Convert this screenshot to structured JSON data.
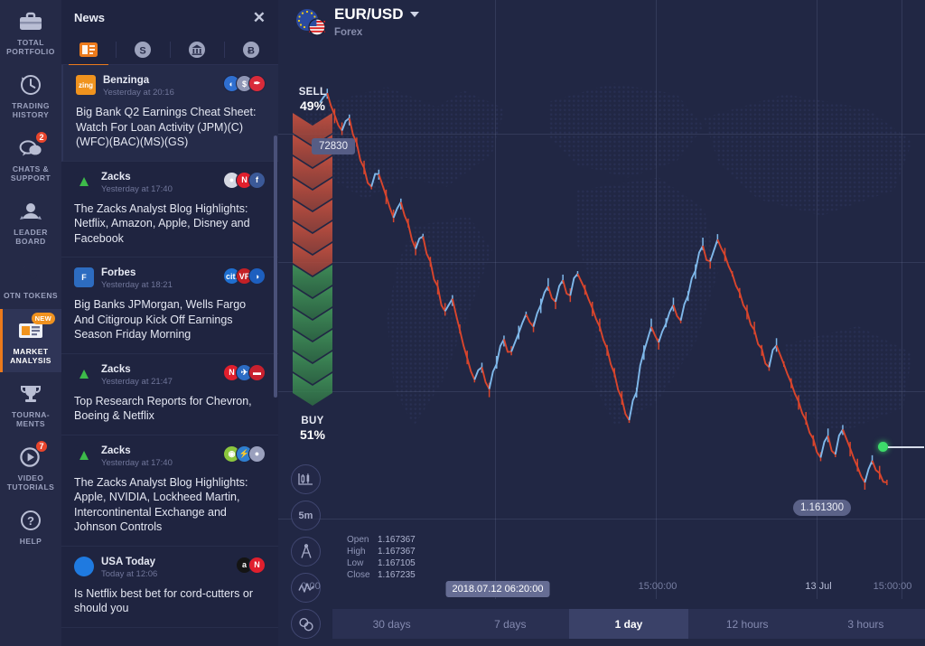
{
  "nav": {
    "items": [
      {
        "label": "TOTAL PORTFOLIO",
        "icon": "briefcase-icon",
        "badge": null,
        "active": false
      },
      {
        "label": "TRADING HISTORY",
        "icon": "clock-history-icon",
        "badge": null,
        "active": false
      },
      {
        "label": "CHATS & SUPPORT",
        "icon": "chat-bubbles-icon",
        "badge": "2",
        "active": false
      },
      {
        "label": "LEADER BOARD",
        "icon": "podium-icon",
        "badge": null,
        "active": false
      },
      {
        "label": "OTN TOKENS",
        "icon": "otn-token-icon",
        "badge": null,
        "active": false
      },
      {
        "label": "MARKET ANALYSIS",
        "icon": "news-card-icon",
        "badge": "NEW",
        "active": true
      },
      {
        "label": "TOURNA- MENTS",
        "icon": "trophy-icon",
        "badge": null,
        "active": false
      },
      {
        "label": "VIDEO TUTORIALS",
        "icon": "play-circle-icon",
        "badge": "7",
        "active": false
      },
      {
        "label": "HELP",
        "icon": "question-circle-icon",
        "badge": null,
        "active": false
      }
    ]
  },
  "news": {
    "title": "News",
    "close_label": "✕",
    "tabs": [
      {
        "name": "newspaper-icon",
        "glyph": "",
        "active": true
      },
      {
        "name": "dollar-icon",
        "glyph": "S",
        "active": false
      },
      {
        "name": "bank-icon",
        "glyph": "⌂",
        "active": false
      },
      {
        "name": "bitcoin-icon",
        "glyph": "Ƀ",
        "active": false
      }
    ],
    "items": [
      {
        "source": "Benzinga",
        "time": "Yesterday at 20:16",
        "avatar_text": "zing",
        "avatar_color": "#f0931e",
        "tags": [
          {
            "text": "◐",
            "color": "#2f6fd0"
          },
          {
            "text": "$",
            "color": "#8f96b5"
          },
          {
            "text": "✒",
            "color": "#d92b3a"
          }
        ],
        "headline": "Big Bank Q2 Earnings Cheat Sheet: Watch For Loan Activity (JPM)(C)(WFC)(BAC)(MS)(GS)"
      },
      {
        "source": "Zacks",
        "time": "Yesterday at 17:40",
        "avatar_text": "▲",
        "avatar_color": "#1f2440",
        "tags": [
          {
            "text": "●",
            "color": "#d5d8e2"
          },
          {
            "text": "N",
            "color": "#e01f2d"
          },
          {
            "text": "f",
            "color": "#3b5998"
          }
        ],
        "headline": "The Zacks Analyst Blog Highlights: Netflix, Amazon, Apple, Disney and Facebook"
      },
      {
        "source": "Forbes",
        "time": "Yesterday at 18:21",
        "avatar_text": "F",
        "avatar_color": "#2d6cc0",
        "tags": [
          {
            "text": "citi",
            "color": "#1f6fd0"
          },
          {
            "text": "VF",
            "color": "#c32026"
          },
          {
            "text": "◑",
            "color": "#1d5fbf"
          }
        ],
        "headline": "Big Banks JPMorgan, Wells Fargo And Citigroup Kick Off Earnings Season Friday Morning"
      },
      {
        "source": "Zacks",
        "time": "Yesterday at 21:47",
        "avatar_text": "▲",
        "avatar_color": "#1f2440",
        "tags": [
          {
            "text": "N",
            "color": "#e01f2d"
          },
          {
            "text": "✈",
            "color": "#2c6cc4"
          },
          {
            "text": "▬",
            "color": "#c8202e"
          }
        ],
        "headline": "Top Research Reports for Chevron, Boeing & Netflix"
      },
      {
        "source": "Zacks",
        "time": "Yesterday at 17:40",
        "avatar_text": "▲",
        "avatar_color": "#1f2440",
        "tags": [
          {
            "text": "◉",
            "color": "#8cc63e"
          },
          {
            "text": "⚡",
            "color": "#2f7fd0"
          },
          {
            "text": "●",
            "color": "#9aa0bd"
          }
        ],
        "headline": "The Zacks Analyst Blog Highlights: Apple, NVIDIA, Lockheed Martin, Intercontinental Exchange and Johnson Controls"
      },
      {
        "source": "USA Today",
        "time": "Today at 12:06",
        "avatar_text": "",
        "avatar_color": "#1f7ae0",
        "tags": [
          {
            "text": "a",
            "color": "#141414"
          },
          {
            "text": "N",
            "color": "#e01f2d"
          }
        ],
        "headline": "Is Netflix best bet for cord-cutters or should you"
      }
    ]
  },
  "chart": {
    "symbol": "EUR/USD",
    "market_type": "Forex",
    "sentiment": {
      "sell_label": "SELL",
      "sell_percent": "49%",
      "buy_label": "BUY",
      "buy_percent": "51%",
      "sell_color": "#c04a3c",
      "buy_color": "#3d8a4e"
    },
    "tools": [
      {
        "name": "chart-type-icon",
        "label": ""
      },
      {
        "name": "timeframe-icon",
        "label": "5m"
      },
      {
        "name": "drawing-tools-icon",
        "label": ""
      },
      {
        "name": "indicators-icon",
        "label": ""
      },
      {
        "name": "chart-settings-icon",
        "label": ""
      }
    ],
    "ohlc": {
      "open_label": "Open",
      "open_value": "1.167367",
      "high_label": "High",
      "high_value": "1.167367",
      "low_label": "Low",
      "low_value": "1.167105",
      "close_label": "Close",
      "close_value": "1.167235"
    },
    "price_labels": [
      {
        "name": "upper-price-label",
        "text": "72830"
      },
      {
        "name": "current-price-label",
        "text": "1.161300"
      }
    ],
    "time_ticks": [
      {
        "text": "0:00",
        "highlight": false,
        "bold": false
      },
      {
        "text": "2018.07.12 06:20:00",
        "highlight": true,
        "bold": false
      },
      {
        "text": "15:00:00",
        "highlight": false,
        "bold": false
      },
      {
        "text": "13 Jul",
        "highlight": false,
        "bold": true
      },
      {
        "text": "15:00:00",
        "highlight": false,
        "bold": false
      }
    ],
    "timeframes": [
      {
        "label": "30 days",
        "active": false
      },
      {
        "label": "7 days",
        "active": false
      },
      {
        "label": "1 day",
        "active": true
      },
      {
        "label": "12 hours",
        "active": false
      },
      {
        "label": "3 hours",
        "active": false
      }
    ]
  },
  "chart_data": {
    "type": "line",
    "title": "EUR/USD",
    "xlabel": "",
    "ylabel": "",
    "x": [
      "0:00",
      "2018.07.12 06:20:00",
      "15:00:00",
      "13 Jul",
      "15:00:00"
    ],
    "ylim": [
      1.1605,
      1.174
    ],
    "up_color": "#7fb8ea",
    "down_color": "#d9452c",
    "series": [
      {
        "name": "EUR/USD close",
        "values": [
          1.1735,
          1.1738,
          1.1731,
          1.1726,
          1.173,
          1.1722,
          1.1714,
          1.1708,
          1.1712,
          1.1705,
          1.1698,
          1.1703,
          1.1696,
          1.1688,
          1.1692,
          1.1684,
          1.1676,
          1.1668,
          1.1672,
          1.1662,
          1.1653,
          1.1646,
          1.165,
          1.1643,
          1.1651,
          1.1659,
          1.1655,
          1.1661,
          1.1667,
          1.1663,
          1.167,
          1.1676,
          1.1671,
          1.1678,
          1.1673,
          1.168,
          1.1675,
          1.1669,
          1.1663,
          1.1656,
          1.1648,
          1.164,
          1.1633,
          1.1642,
          1.1655,
          1.1663,
          1.1658,
          1.1664,
          1.167,
          1.1665,
          1.1673,
          1.1681,
          1.1689,
          1.1684,
          1.1691,
          1.1686,
          1.168,
          1.1674,
          1.1668,
          1.1662,
          1.1656,
          1.165,
          1.1657,
          1.1651,
          1.1645,
          1.1639,
          1.1633,
          1.1627,
          1.1621,
          1.1628,
          1.1622,
          1.163,
          1.1624,
          1.1618,
          1.1613,
          1.162,
          1.1616,
          1.1613
        ]
      }
    ],
    "annotations": [
      {
        "text": "72830",
        "kind": "price-label"
      },
      {
        "text": "1.161300",
        "kind": "current-price-label"
      }
    ],
    "grid": true,
    "legend": false
  }
}
